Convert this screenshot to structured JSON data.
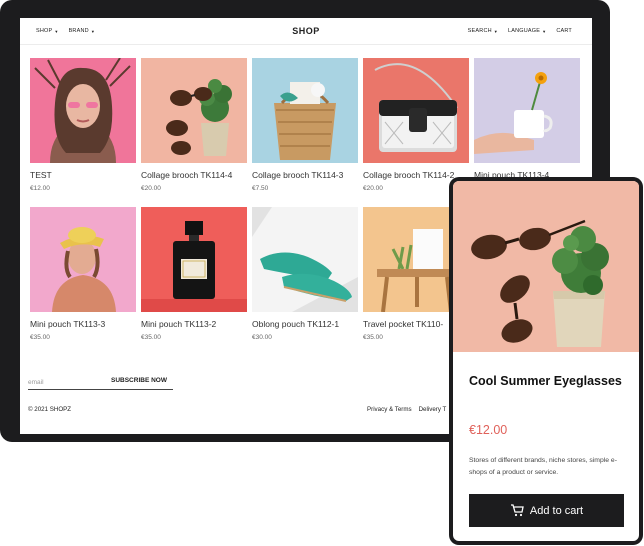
{
  "desktop": {
    "nav_left": [
      {
        "label": "SHOP",
        "icon": "caret-down-icon"
      },
      {
        "label": "BRAND",
        "icon": "caret-down-icon"
      }
    ],
    "logo": "SHOP",
    "nav_right": [
      {
        "label": "SEARCH",
        "icon": "caret-down-icon"
      },
      {
        "label": "LANGUAGE",
        "icon": "caret-down-icon"
      },
      {
        "label": "CART"
      }
    ],
    "products": [
      {
        "name": "TEST",
        "price": "€12.00"
      },
      {
        "name": "Collage brooch TK114-4",
        "price": "€20.00"
      },
      {
        "name": "Collage brooch TK114-3",
        "price": "€7.50"
      },
      {
        "name": "Collage brooch TK114-2",
        "price": "€20.00"
      },
      {
        "name": "Mini pouch TK113-4",
        "price": ""
      },
      {
        "name": "Mini pouch TK113-3",
        "price": "€35.00"
      },
      {
        "name": "Mini pouch TK113-2",
        "price": "€35.00"
      },
      {
        "name": "Oblong pouch TK112-1",
        "price": "€30.00"
      },
      {
        "name": "Travel pocket TK110-",
        "price": "€35.00"
      }
    ],
    "subscribe": {
      "placeholder": "email",
      "button": "SUBSCRIBE NOW"
    },
    "footer": {
      "copyright": "© 2021 SHOPZ",
      "links": [
        "Privacy & Terms",
        "Delivery T"
      ]
    }
  },
  "mobile": {
    "title": "Cool Summer Eyeglasses",
    "price": "€12.00",
    "description": "Stores of different brands, niche stores, simple e-shops of a product or service.",
    "button": "Add to cart",
    "button_icon": "cart-icon"
  },
  "colors": {
    "frame": "#1c1c1e",
    "price_accent": "#e0615a",
    "button_bg": "#1c1c1e"
  }
}
